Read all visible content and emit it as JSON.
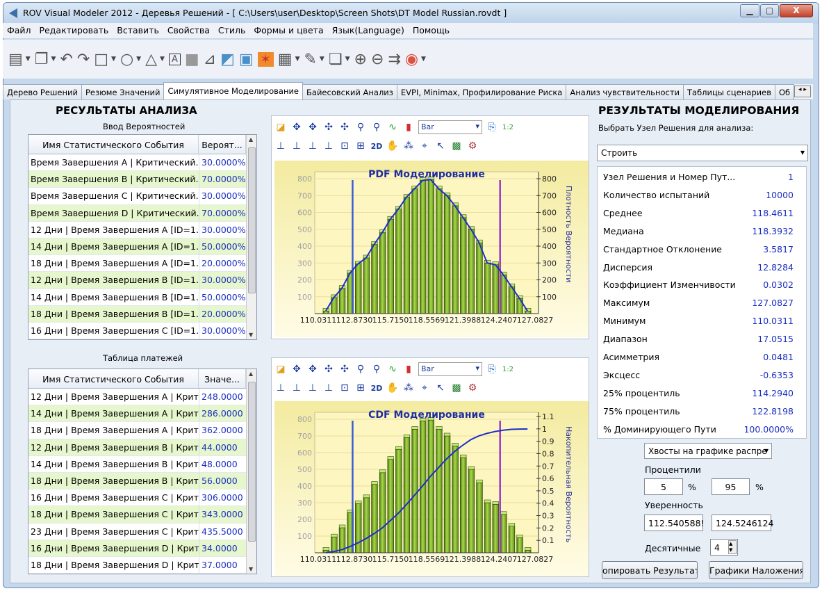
{
  "window": {
    "title": "ROV Visual Modeler 2012 - Деревья Решений - [ C:\\Users\\user\\Desktop\\Screen Shots\\DT Model Russian.rovdt ]",
    "minimize": "▁",
    "maximize": "▢",
    "close": "X"
  },
  "menu": [
    "Файл",
    "Редактировать",
    "Вставить",
    "Свойства",
    "Стиль",
    "Формы и цвета",
    "Язык(Language)",
    "Помощь"
  ],
  "toolbar_buttons": [
    {
      "name": "new-icon",
      "glyph": "▤"
    },
    {
      "name": "copy-icon",
      "glyph": "❐"
    },
    {
      "name": "undo-icon",
      "glyph": "↶"
    },
    {
      "name": "redo-icon",
      "glyph": "↷"
    },
    {
      "name": "rectangle-icon",
      "glyph": "□"
    },
    {
      "name": "ellipse-icon",
      "glyph": "○"
    },
    {
      "name": "triangle-icon",
      "glyph": "△"
    },
    {
      "name": "textbox-icon",
      "glyph": "A"
    },
    {
      "name": "shade-icon",
      "glyph": "■"
    },
    {
      "name": "chart-scale-icon",
      "glyph": "⊿"
    },
    {
      "name": "image-icon",
      "glyph": "◩"
    },
    {
      "name": "picture-icon",
      "glyph": "▣"
    },
    {
      "name": "simulation-icon",
      "glyph": "✶"
    },
    {
      "name": "calculator-icon",
      "glyph": "▦"
    },
    {
      "name": "edit-icon",
      "glyph": "✎"
    },
    {
      "name": "pages-icon",
      "glyph": "❏"
    },
    {
      "name": "zoom-in-icon",
      "glyph": "⊕"
    },
    {
      "name": "zoom-out-icon",
      "glyph": "⊖"
    },
    {
      "name": "export-icon",
      "glyph": "⇉"
    },
    {
      "name": "license-icon",
      "glyph": "◉"
    }
  ],
  "tabs": [
    "Дерево Решений",
    "Резюме Значений",
    "Симулятивное Моделирование",
    "Байесовский Анализ",
    "EVPI, Minimax, Профилирование Риска",
    "Анализ чувствительности",
    "Таблицы сценариев",
    "Об"
  ],
  "left": {
    "title": "РЕСУЛЬТАТЫ АНАЛИЗА",
    "prob_caption": "Ввод Вероятностей",
    "prob_headers": [
      "Имя Статистического События",
      "Вероят..."
    ],
    "prob_rows": [
      [
        "Время Завершения A | Критический...",
        "30.0000%"
      ],
      [
        "Время Завершения B | Критический...",
        "70.0000%"
      ],
      [
        "Время Завершения C | Критический...",
        "30.0000%"
      ],
      [
        "Время Завершения D | Критический...",
        "70.0000%"
      ],
      [
        "12 Дни | Время Завершения A [ID=1....",
        "30.0000%"
      ],
      [
        "14 Дни | Время Завершения A [ID=1....",
        "50.0000%"
      ],
      [
        "18 Дни | Время Завершения A [ID=1....",
        "20.0000%"
      ],
      [
        "12 Дни | Время Завершения B [ID=1....",
        "30.0000%"
      ],
      [
        "14 Дни | Время Завершения B [ID=1....",
        "50.0000%"
      ],
      [
        "18 Дни | Время Завершения B [ID=1....",
        "20.0000%"
      ],
      [
        "16 Дни | Время Завершения C [ID=1....",
        "30.0000%"
      ]
    ],
    "pay_caption": "Таблица платежей",
    "pay_headers": [
      "Имя Статистического События",
      "Значе..."
    ],
    "pay_rows": [
      [
        "12 Дни | Время Завершения A | Крит...",
        "248.0000"
      ],
      [
        "14 Дни | Время Завершения A | Крит...",
        "286.0000"
      ],
      [
        "18 Дни | Время Завершения A | Крит...",
        "362.0000"
      ],
      [
        "12 Дни | Время Завершения B | Крит...",
        "44.0000"
      ],
      [
        "14 Дни | Время Завершения B | Крит...",
        "48.0000"
      ],
      [
        "18 Дни | Время Завершения B | Крит...",
        "56.0000"
      ],
      [
        "16 Дни | Время Завершения C | Крит...",
        "306.0000"
      ],
      [
        "18 Дни | Время Завершения C | Крит...",
        "343.0000"
      ],
      [
        "23 Дни | Время Завершения C | Крит...",
        "435.5000"
      ],
      [
        "16 Дни | Время Завершения D | Крит...",
        "34.0000"
      ],
      [
        "18 Дни | Время Завершения D | Крит...",
        "37.0000"
      ]
    ]
  },
  "chart_tools": {
    "row1": [
      {
        "name": "palette-icon",
        "glyph": "◪"
      },
      {
        "name": "move-left-icon",
        "glyph": "✥"
      },
      {
        "name": "move-right-icon",
        "glyph": "✥"
      },
      {
        "name": "pan-up-icon",
        "glyph": "✣"
      },
      {
        "name": "pan-down-icon",
        "glyph": "✣"
      },
      {
        "name": "zoom-area-icon",
        "glyph": "⚲"
      },
      {
        "name": "zoom-reset-icon",
        "glyph": "⚲"
      },
      {
        "name": "line-chart-icon",
        "glyph": "∿"
      },
      {
        "name": "bar-chart-icon",
        "glyph": "▮"
      }
    ],
    "chart_type": "Bar",
    "row1_end": [
      {
        "name": "copy-chart-icon",
        "glyph": "⎘"
      },
      {
        "name": "ratio-icon",
        "glyph": "1:2"
      }
    ],
    "row2": [
      {
        "name": "axis-left-icon",
        "glyph": "⊥"
      },
      {
        "name": "axis-right-icon",
        "glyph": "⊥"
      },
      {
        "name": "axis-up-icon",
        "glyph": "⊥"
      },
      {
        "name": "axis-down-icon",
        "glyph": "⊥"
      },
      {
        "name": "3d-box-icon",
        "glyph": "⊡"
      },
      {
        "name": "3d-view-icon",
        "glyph": "⊞"
      },
      {
        "name": "2d-label",
        "glyph": "2D"
      },
      {
        "name": "hand-icon",
        "glyph": "✋"
      },
      {
        "name": "points-icon",
        "glyph": "⁂"
      },
      {
        "name": "crosshair-icon",
        "glyph": "⌖"
      },
      {
        "name": "cursor-icon",
        "glyph": "↖"
      },
      {
        "name": "colors-icon",
        "glyph": "▩"
      },
      {
        "name": "settings-icon",
        "glyph": "⚙"
      }
    ]
  },
  "chart_data": [
    {
      "type": "bar",
      "title": "PDF Моделирование",
      "ylabel_right": "Плотность Вероятности",
      "x_ticks": [
        "110.0311",
        "112.8730",
        "115.7150",
        "118.5569",
        "121.3988",
        "124.2407",
        "127.0827"
      ],
      "ylim": [
        0,
        800
      ],
      "yticks": [
        100,
        200,
        300,
        400,
        500,
        600,
        700,
        800
      ],
      "yticks_right": [
        "100",
        "200",
        "300",
        "400",
        "500",
        "600",
        "700",
        "800"
      ],
      "values": [
        15,
        95,
        150,
        240,
        295,
        330,
        410,
        480,
        560,
        620,
        690,
        740,
        790,
        795,
        740,
        700,
        640,
        570,
        500,
        420,
        300,
        290,
        230,
        160,
        90,
        15
      ],
      "curve": [
        15,
        95,
        150,
        240,
        295,
        330,
        410,
        480,
        560,
        620,
        690,
        740,
        790,
        795,
        740,
        700,
        640,
        570,
        500,
        420,
        300,
        290,
        230,
        160,
        90,
        15
      ],
      "lines": [
        {
          "at": 112.5406,
          "color": "#3b5bd6"
        },
        {
          "at": 124.5246,
          "color": "#a035c8"
        }
      ],
      "xlim": [
        110.0311,
        127.0827
      ]
    },
    {
      "type": "bar",
      "title": "CDF Моделирование",
      "ylabel_right": "Накопительная Вероятность",
      "x_ticks": [
        "110.0311",
        "112.8730",
        "115.7150",
        "118.5569",
        "121.3988",
        "124.2407",
        "127.0827"
      ],
      "ylim": [
        0,
        800
      ],
      "yticks": [
        100,
        200,
        300,
        400,
        500,
        600,
        700,
        800
      ],
      "yticks_right": [
        "0.1",
        "0.2",
        "0.3",
        "0.4",
        "0.5",
        "0.6",
        "0.7",
        "0.8",
        "0.9",
        "1",
        "1.1"
      ],
      "values": [
        15,
        95,
        150,
        240,
        295,
        330,
        410,
        480,
        560,
        620,
        690,
        740,
        790,
        795,
        740,
        700,
        640,
        570,
        500,
        420,
        300,
        290,
        230,
        160,
        90,
        15
      ],
      "cdf": [
        0.001,
        0.01,
        0.025,
        0.05,
        0.08,
        0.115,
        0.155,
        0.2,
        0.26,
        0.32,
        0.39,
        0.465,
        0.54,
        0.62,
        0.69,
        0.76,
        0.82,
        0.87,
        0.915,
        0.945,
        0.965,
        0.98,
        0.99,
        0.997,
        0.999,
        1.0
      ],
      "lines": [
        {
          "at": 112.5406,
          "color": "#3b5bd6"
        },
        {
          "at": 124.5246,
          "color": "#a035c8"
        }
      ],
      "xlim": [
        110.0311,
        127.0827
      ]
    }
  ],
  "right": {
    "title": "РЕЗУЛЬТАТЫ МОДЕЛИРОВАНИЯ",
    "select_label": "Выбрать Узел Решения для анализа:",
    "select_value": "Строить",
    "stats": [
      [
        "Узел Решения и Номер Пут...",
        "1"
      ],
      [
        "Количество испытаний",
        "10000"
      ],
      [
        "Среднее",
        "118.4611"
      ],
      [
        "Медиана",
        "118.3932"
      ],
      [
        "Стандартное Отклонение",
        "3.5817"
      ],
      [
        "Дисперсия",
        "12.8284"
      ],
      [
        "Коэффициент Изменчивости",
        "0.0302"
      ],
      [
        "Максимум",
        "127.0827"
      ],
      [
        "Минимум",
        "110.0311"
      ],
      [
        "Диапазон",
        "17.0515"
      ],
      [
        "Асимметрия",
        "0.0481"
      ],
      [
        "Эксцесс",
        "-0.6353"
      ],
      [
        "25% процентиль",
        "114.2940"
      ],
      [
        "75% процентиль",
        "122.8198"
      ],
      [
        "% Доминирующего Пути",
        "100.0000%"
      ]
    ],
    "tails_select": "Хвосты на графике распре",
    "percentiles_label": "Процентили",
    "p_low": "5",
    "p_high": "95",
    "pct": "%",
    "confidence_label": "Уверенность",
    "conf_low": "112.540588!",
    "conf_high": "124.5246124",
    "decimals_label": "Десятичные",
    "decimals": "4",
    "copy_button": "опировать Результать",
    "overlay_button": "Графики Наложения"
  }
}
